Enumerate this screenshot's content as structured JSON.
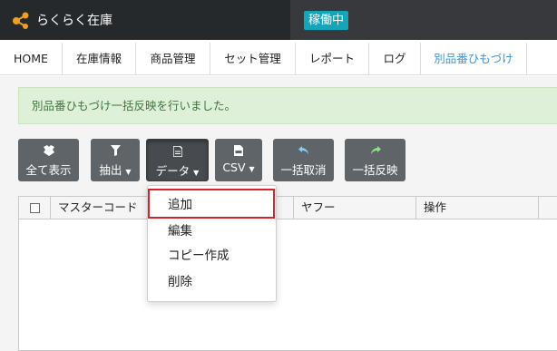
{
  "app": {
    "title": "らくらく在庫",
    "status": "稼働中"
  },
  "nav": {
    "items": [
      {
        "label": "HOME"
      },
      {
        "label": "在庫情報"
      },
      {
        "label": "商品管理"
      },
      {
        "label": "セット管理"
      },
      {
        "label": "レポート"
      },
      {
        "label": "ログ"
      },
      {
        "label": "別品番ひもづけ"
      }
    ],
    "active": "別品番ひもづけ"
  },
  "alert": {
    "message": "別品番ひもづけ一括反映を行いました。"
  },
  "toolbar": {
    "show_all": "全て表示",
    "filter": "抽出",
    "data": "データ",
    "csv": "CSV",
    "bulk_cancel": "一括取消",
    "bulk_apply": "一括反映"
  },
  "table": {
    "columns": [
      "マスターコード",
      "ヤフー",
      "操作"
    ]
  },
  "dropdown": {
    "items": [
      "追加",
      "編集",
      "コピー作成",
      "削除"
    ]
  },
  "colors": {
    "header_bg": "#26292c",
    "status_badge": "#15a5b9",
    "nav_active": "#3a96d8",
    "alert_bg": "#dff0d8",
    "alert_text": "#3c763d",
    "button_bg": "#5f6468",
    "highlight": "#d9232a"
  }
}
